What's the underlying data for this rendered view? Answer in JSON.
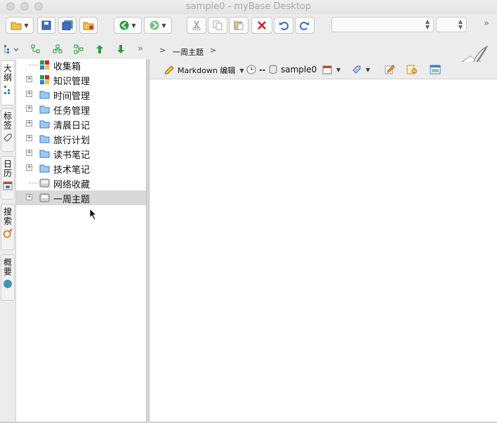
{
  "window": {
    "title": "sample0 - myBase Desktop"
  },
  "toolbar": {
    "buttons": [
      {
        "name": "open-folder-icon",
        "has_menu": true
      },
      {
        "name": "save-icon"
      },
      {
        "name": "save-all-icon"
      },
      {
        "name": "close-db-icon"
      },
      {
        "name": "back-arrow-icon",
        "has_menu": true
      },
      {
        "name": "forward-arrow-icon",
        "has_menu": true
      },
      {
        "name": "cut-icon"
      },
      {
        "name": "copy-icon"
      },
      {
        "name": "paste-icon"
      },
      {
        "name": "delete-icon"
      },
      {
        "name": "undo-icon"
      },
      {
        "name": "redo-icon"
      }
    ],
    "font_combo_value": "",
    "size_combo_value": "",
    "more": "»"
  },
  "outline_toolbar": {
    "more": "»"
  },
  "side_tabs": [
    {
      "label": "大纲",
      "icon": "outline-icon",
      "active": true
    },
    {
      "label": "标签",
      "icon": "tag-icon"
    },
    {
      "label": "日历",
      "icon": "calendar-icon"
    },
    {
      "label": "搜索",
      "icon": "search-icon"
    },
    {
      "label": "概要",
      "icon": "globe-icon"
    }
  ],
  "tree": {
    "items": [
      {
        "label": "收集箱",
        "expandable": false,
        "icon": "inbox"
      },
      {
        "label": "知识管理",
        "expandable": true,
        "icon": "inbox"
      },
      {
        "label": "时间管理",
        "expandable": true,
        "icon": "folder"
      },
      {
        "label": "任务管理",
        "expandable": true,
        "icon": "folder"
      },
      {
        "label": "清晨日记",
        "expandable": true,
        "icon": "folder"
      },
      {
        "label": "旅行计划",
        "expandable": true,
        "icon": "folder"
      },
      {
        "label": "读书笔记",
        "expandable": true,
        "icon": "folder"
      },
      {
        "label": "技术笔记",
        "expandable": true,
        "icon": "folder"
      },
      {
        "label": "网络收藏",
        "expandable": false,
        "icon": "archive"
      },
      {
        "label": "一周主题",
        "expandable": true,
        "icon": "archive",
        "selected": true
      }
    ]
  },
  "breadcrumb": {
    "sep": ">",
    "item": "一周主题"
  },
  "doc_toolbar": {
    "editor_mode": "Markdown 编辑",
    "time_value": "--",
    "database": "sample0"
  },
  "colors": {
    "accent_green": "#2e9e3a",
    "selected_row": "#d9d9d9"
  }
}
